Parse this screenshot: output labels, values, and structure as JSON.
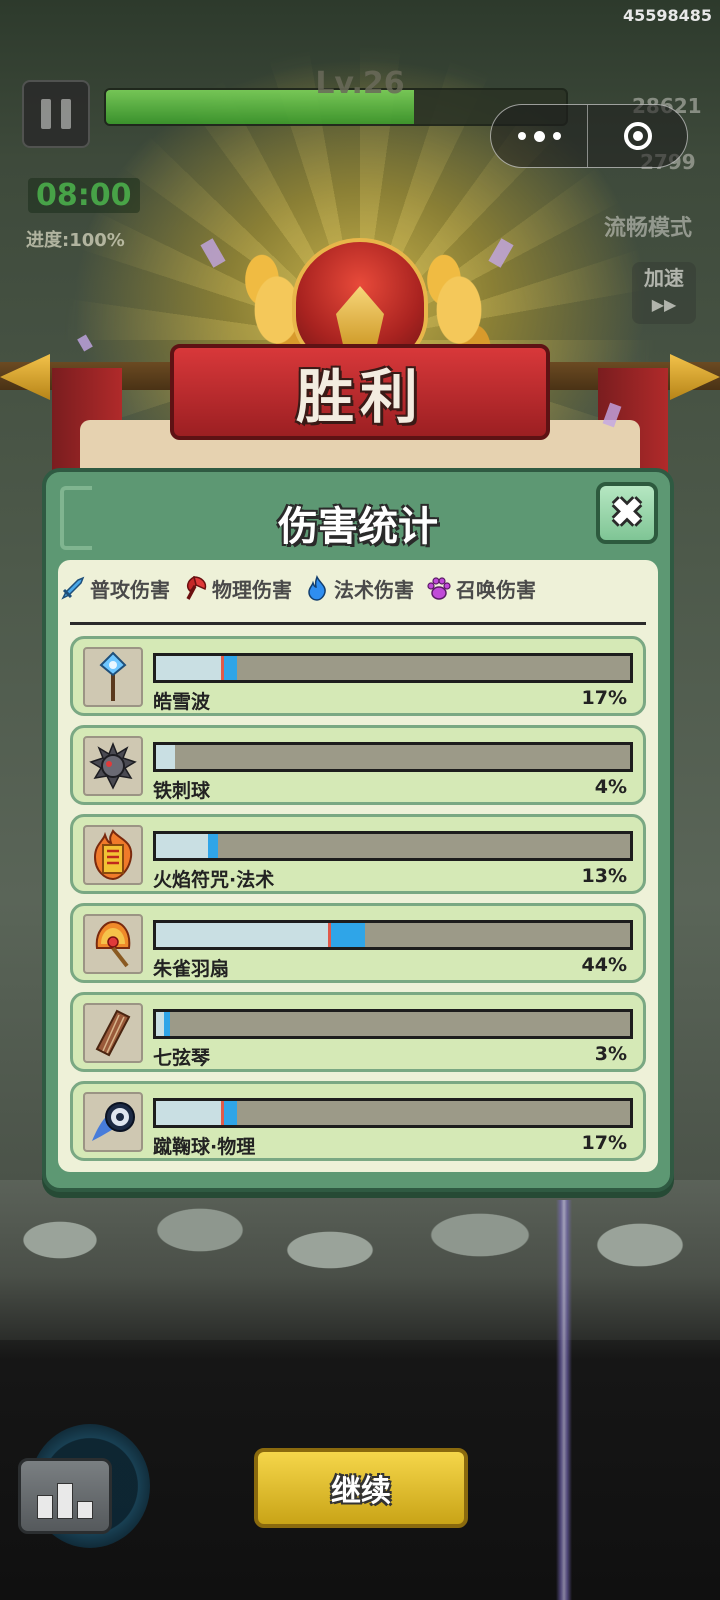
{
  "game_id": "45598485",
  "hud": {
    "level": "Lv.26",
    "level_progress": 0.67,
    "coins": "28621",
    "kills": "2799",
    "timer": "08:00",
    "progress_label": "进度:100%",
    "smooth_mode": "流畅模式",
    "speed_label": "加速",
    "speed_glyph": "▶▶"
  },
  "victory": {
    "title": "胜利"
  },
  "dialog": {
    "title": "伤害统计",
    "close_glyph": "✖",
    "tabs": [
      {
        "label": "普攻伤害",
        "icon": "sword-icon",
        "color": "#4aa8e8"
      },
      {
        "label": "物理伤害",
        "icon": "axe-icon",
        "color": "#e03a3a"
      },
      {
        "label": "法术伤害",
        "icon": "flame-icon",
        "color": "#2f8ef0"
      },
      {
        "label": "召唤伤害",
        "icon": "paw-icon",
        "color": "#c04ad8"
      }
    ],
    "rows": [
      {
        "name": "皓雪波",
        "percent_text": "17%",
        "fill": 0.17,
        "icon": "snow-scepter-icon"
      },
      {
        "name": "铁刺球",
        "percent_text": "4%",
        "fill": 0.04,
        "icon": "spiked-ball-icon"
      },
      {
        "name": "火焰符咒·法术",
        "percent_text": "13%",
        "fill": 0.13,
        "icon": "fire-talisman-icon"
      },
      {
        "name": "朱雀羽扇",
        "percent_text": "44%",
        "fill": 0.44,
        "icon": "feather-fan-icon"
      },
      {
        "name": "七弦琴",
        "percent_text": "3%",
        "fill": 0.03,
        "icon": "zither-icon"
      },
      {
        "name": "蹴鞠球·物理",
        "percent_text": "17%",
        "fill": 0.17,
        "icon": "kickball-icon"
      }
    ]
  },
  "bottom": {
    "continue_label": "继续"
  },
  "colors": {
    "dialog_green": "#5d9873",
    "bar_blue": "#2fa5e8",
    "bar_red_mark": "#e05a4a",
    "victory_red": "#c42c2e",
    "continue_yellow": "#e8c62e"
  }
}
